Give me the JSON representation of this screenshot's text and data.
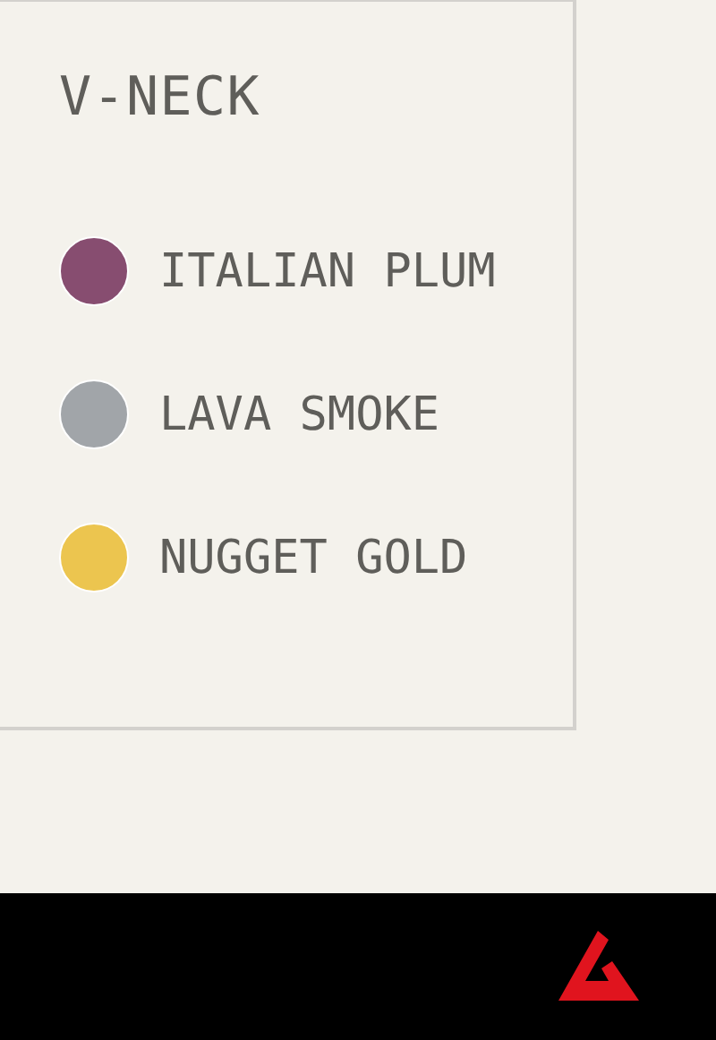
{
  "card": {
    "title": "V-NECK",
    "colors": [
      {
        "name": "ITALIAN PLUM",
        "color": "#874d70"
      },
      {
        "name": "LAVA SMOKE",
        "color": "#a1a5a9"
      },
      {
        "name": "NUGGET GOLD",
        "color": "#ecc54f"
      }
    ]
  }
}
